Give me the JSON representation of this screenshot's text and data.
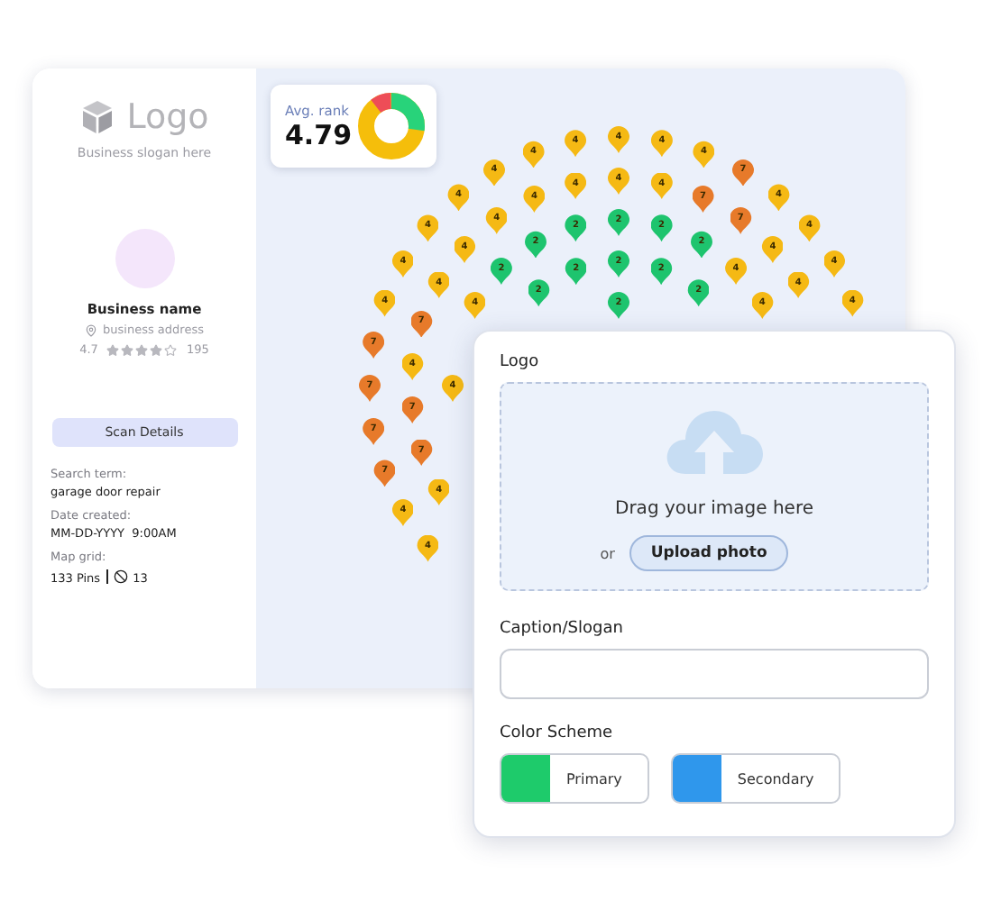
{
  "sidebar": {
    "logo": "Logo",
    "slogan": "Business slogan here",
    "business_name": "Business name",
    "address": "business address",
    "rating": "4.7",
    "stars": 4,
    "reviews": "195",
    "scan_button": "Scan Details",
    "details": [
      {
        "label": "Search term:",
        "value": "garage door repair"
      },
      {
        "label": "Date created:",
        "value": "MM-DD-YYYY  9:00AM"
      }
    ],
    "map_grid": {
      "label": "Map grid:",
      "pins": "133 Pins",
      "blocked": "13"
    }
  },
  "avg_rank": {
    "label": "Avg. rank",
    "value": "4.79"
  },
  "map": {
    "pins": [
      {
        "rank": "4",
        "color": "#f5b914"
      },
      {
        "rank": "4",
        "color": "#f5b914"
      },
      {
        "rank": "4",
        "color": "#f5b914"
      },
      {
        "rank": "4",
        "color": "#f5b914"
      },
      {
        "rank": "4",
        "color": "#f5b914"
      },
      {
        "rank": "4",
        "color": "#f5b914"
      },
      {
        "rank": "7",
        "color": "#e77a2a"
      },
      {
        "rank": "4",
        "color": "#f5b914"
      },
      {
        "rank": "4",
        "color": "#f5b914"
      },
      {
        "rank": "4",
        "color": "#f5b914"
      },
      {
        "rank": "4",
        "color": "#f5b914"
      },
      {
        "rank": "4",
        "color": "#f5b914"
      },
      {
        "rank": "7",
        "color": "#e77a2a"
      },
      {
        "rank": "4",
        "color": "#f5b914"
      },
      {
        "rank": "4",
        "color": "#f5b914"
      },
      {
        "rank": "2",
        "color": "#1ec46e"
      },
      {
        "rank": "7",
        "color": "#e77a2a"
      },
      {
        "rank": "4",
        "color": "#f5b914"
      },
      {
        "rank": "2",
        "color": "#1ec46e"
      },
      {
        "rank": "2",
        "color": "#1ec46e"
      },
      {
        "rank": "4",
        "color": "#f5b914"
      },
      {
        "rank": "2",
        "color": "#1ec46e"
      },
      {
        "rank": "2",
        "color": "#1ec46e"
      },
      {
        "rank": "4",
        "color": "#f5b914"
      },
      {
        "rank": "4",
        "color": "#f5b914"
      },
      {
        "rank": "4",
        "color": "#f5b914"
      },
      {
        "rank": "2",
        "color": "#1ec46e"
      },
      {
        "rank": "4",
        "color": "#f5b914"
      },
      {
        "rank": "2",
        "color": "#1ec46e"
      },
      {
        "rank": "2",
        "color": "#1ec46e"
      },
      {
        "rank": "2",
        "color": "#1ec46e"
      },
      {
        "rank": "4",
        "color": "#f5b914"
      },
      {
        "rank": "4",
        "color": "#f5b914"
      },
      {
        "rank": "4",
        "color": "#f5b914"
      },
      {
        "rank": "2",
        "color": "#1ec46e"
      },
      {
        "rank": "2",
        "color": "#1ec46e"
      },
      {
        "rank": "4",
        "color": "#f5b914"
      },
      {
        "rank": "4",
        "color": "#f5b914"
      },
      {
        "rank": "2",
        "color": "#1ec46e"
      },
      {
        "rank": "4",
        "color": "#f5b914"
      },
      {
        "rank": "4",
        "color": "#f5b914"
      },
      {
        "rank": "7",
        "color": "#e77a2a"
      },
      {
        "rank": "7",
        "color": "#e77a2a"
      },
      {
        "rank": "4",
        "color": "#f5b914"
      },
      {
        "rank": "7",
        "color": "#e77a2a"
      },
      {
        "rank": "4",
        "color": "#f5b914"
      },
      {
        "rank": "7",
        "color": "#e77a2a"
      },
      {
        "rank": "7",
        "color": "#e77a2a"
      },
      {
        "rank": "7",
        "color": "#e77a2a"
      },
      {
        "rank": "7",
        "color": "#e77a2a"
      },
      {
        "rank": "4",
        "color": "#f5b914"
      },
      {
        "rank": "4",
        "color": "#f5b914"
      },
      {
        "rank": "4",
        "color": "#f5b914"
      }
    ]
  },
  "form": {
    "logo_label": "Logo",
    "drop_text": "Drag your image here",
    "or": "or",
    "upload_button": "Upload photo",
    "caption_label": "Caption/Slogan",
    "scheme_label": "Color Scheme",
    "swatches": [
      {
        "label": "Primary",
        "color": "#1ecb6b"
      },
      {
        "label": "Secondary",
        "color": "#2f97ec"
      }
    ]
  }
}
